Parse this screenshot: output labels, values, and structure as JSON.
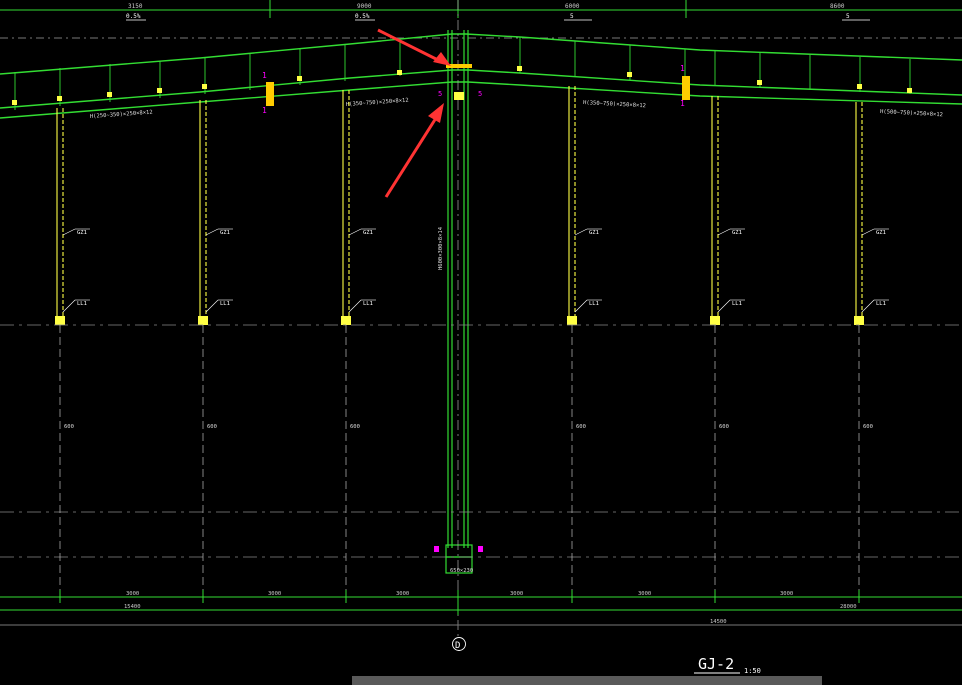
{
  "drawing": {
    "title": "GJ-2",
    "scale": "1:50",
    "axis_label": "D",
    "colors": {
      "background": "#000000",
      "structure": "#33dd33",
      "column": "#ffff44",
      "annotation": "#ffffff",
      "dimension_line": "#7f7f7f",
      "section_mark": "#ff00ff",
      "arrow": "#ff3333"
    },
    "top_dims": [
      "3150",
      "9000",
      "6000",
      "8600"
    ],
    "slopes": [
      "0.5%",
      "0.5%",
      "5",
      "5"
    ],
    "beam_labels": [
      "H(250~350)×250×8×12",
      "H(350~750)×250×8×12",
      "H(350~750)×250×8×12",
      "H(500~750)×250×8×12"
    ],
    "column_label": "H600×300×8×14",
    "base_label": "650×230",
    "section_marks": [
      "1",
      "1",
      "1",
      "1",
      "5",
      "5"
    ],
    "bottom_dims": [
      "3000",
      "3000",
      "3000",
      "3000",
      "3000",
      "3000"
    ],
    "overall_dims": [
      "15400",
      "14500",
      "28000"
    ],
    "column_tags": [
      "GZ1",
      "GZ1",
      "GZ1",
      "GZ1",
      "GZ1",
      "GZ1"
    ],
    "base_tags": [
      "LL1",
      "LL1",
      "LL1",
      "LL1",
      "LL1",
      "LL1"
    ],
    "mid_tags": [
      "600",
      "600",
      "600",
      "600",
      "600",
      "600"
    ],
    "purlin_marks": [
      "1500",
      "1500",
      "1500",
      "1500",
      "1500",
      "1500",
      "1500",
      "1500",
      "1500",
      "1500",
      "1500",
      "1500"
    ]
  }
}
